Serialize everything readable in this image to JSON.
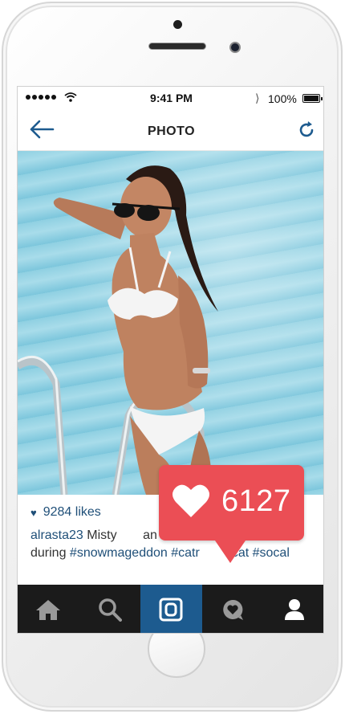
{
  "status_bar": {
    "time": "9:41 PM",
    "battery": "100%",
    "icons": [
      "signal-dots-icon",
      "wifi-icon",
      "bluetooth-icon",
      "battery-icon"
    ]
  },
  "nav": {
    "title": "PHOTO",
    "icons": [
      "back-arrow-icon",
      "refresh-icon"
    ]
  },
  "post": {
    "likes": "9284 likes",
    "username": "alrasta23",
    "caption_start": " Misty",
    "caption_mid": "an",
    "caption_line2_prefix": "during ",
    "hashtags": [
      "#snowmageddon",
      "#catr",
      "cat",
      "#socal"
    ]
  },
  "notification": {
    "count": "6127",
    "icon": "heart-icon"
  },
  "tab_bar": {
    "tabs": [
      "home-icon",
      "search-icon",
      "camera-icon",
      "activity-icon",
      "profile-icon"
    ],
    "active_index": 2
  },
  "colors": {
    "accent_blue": "#1d5b8f",
    "notification_red": "#eb4e55",
    "tab_bar_bg": "#1b1b1b"
  }
}
